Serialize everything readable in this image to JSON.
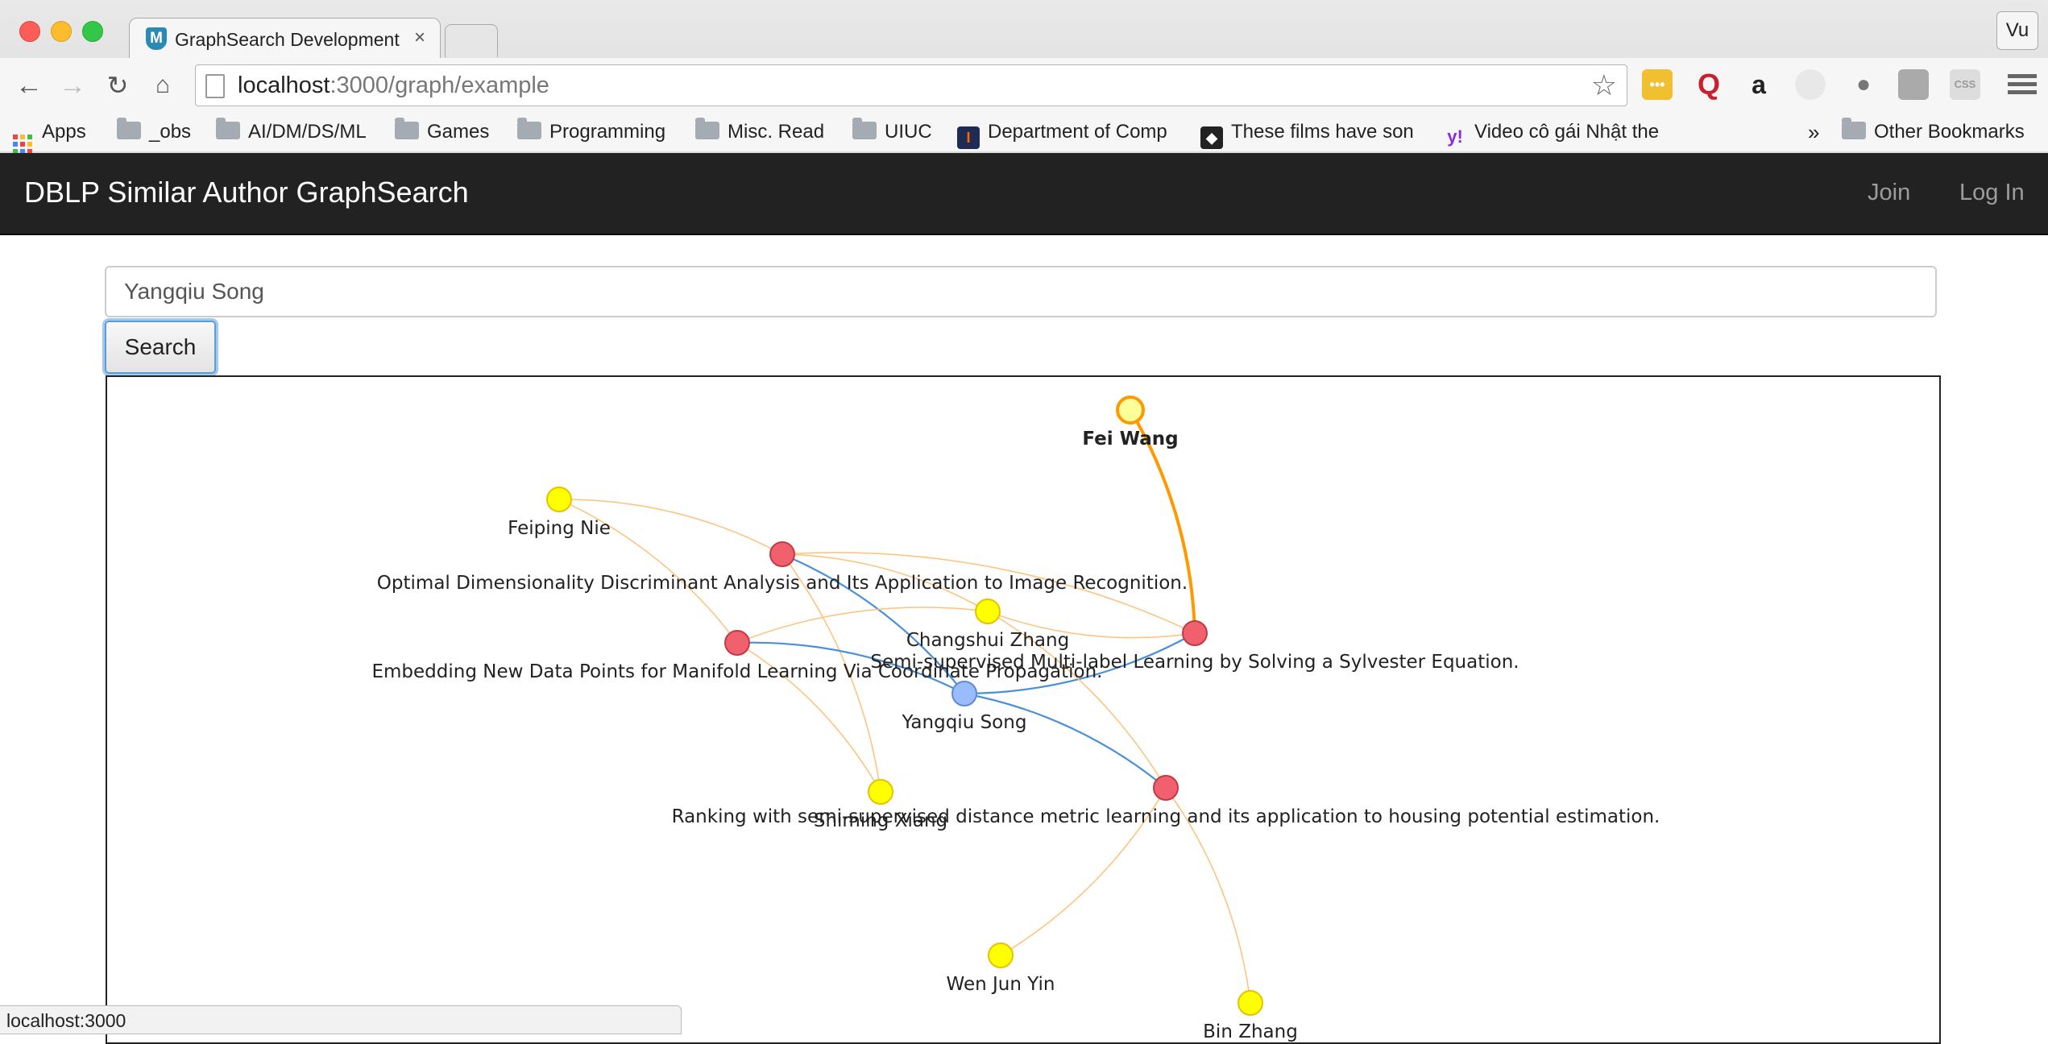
{
  "browser": {
    "tab_title": "GraphSearch Development",
    "tab_close": "×",
    "tab_favicon": "M",
    "profile": "Vu",
    "url_host": "localhost",
    "url_path": ":3000/graph/example",
    "bookmarks": {
      "apps": "Apps",
      "obs": "_obs",
      "ai": "AI/DM/DS/ML",
      "games": "Games",
      "programming": "Programming",
      "misc": "Misc. Read",
      "uiuc": "UIUC",
      "dept": "Department of Comp",
      "films": "These films have son",
      "video": "Video cô gái Nhật the",
      "more": "»",
      "other": "Other Bookmarks"
    },
    "extensions": {
      "q_label": "Q",
      "a_label": "a"
    },
    "status_url": "localhost:3000"
  },
  "app": {
    "brand": "DBLP Similar Author GraphSearch",
    "join": "Join",
    "login": "Log In"
  },
  "search": {
    "value": "Yangqiu Song",
    "button": "Search"
  },
  "graph": {
    "colors": {
      "author": "#ffff00",
      "paper": "#f0616d",
      "center": "#99bbff",
      "selected": "#ffff99",
      "link_author": "#ffc07a",
      "link_center": "#4a90d9",
      "link_selected": "#ff9900"
    },
    "nodes": [
      {
        "id": "fei",
        "label": "Fei Wang",
        "kind": "selected"
      },
      {
        "id": "feiping",
        "label": "Feiping Nie",
        "kind": "author"
      },
      {
        "id": "p1",
        "label": "Optimal Dimensionality Discriminant Analysis and Its Application to Image Recognition.",
        "kind": "paper"
      },
      {
        "id": "changshui",
        "label": "Changshui Zhang",
        "kind": "author"
      },
      {
        "id": "p2",
        "label": "Semi-supervised Multi-label Learning by Solving a Sylvester Equation.",
        "kind": "paper"
      },
      {
        "id": "p3",
        "label": "Embedding New Data Points for Manifold Learning Via Coordinate Propagation.",
        "kind": "paper"
      },
      {
        "id": "yangqiu",
        "label": "Yangqiu Song",
        "kind": "center"
      },
      {
        "id": "shiming",
        "label": "Shiming Xiang",
        "kind": "author"
      },
      {
        "id": "p4",
        "label": "Ranking with semi-supervised distance metric learning and its application to housing potential estimation.",
        "kind": "paper"
      },
      {
        "id": "wenjun",
        "label": "Wen Jun Yin",
        "kind": "author"
      },
      {
        "id": "bin",
        "label": "Bin Zhang",
        "kind": "author"
      }
    ],
    "links": [
      {
        "source": "fei",
        "target": "p2",
        "kind": "selected"
      },
      {
        "source": "feiping",
        "target": "p1",
        "kind": "author"
      },
      {
        "source": "feiping",
        "target": "p3",
        "kind": "author"
      },
      {
        "source": "p1",
        "target": "yangqiu",
        "kind": "center"
      },
      {
        "source": "p1",
        "target": "changshui",
        "kind": "author"
      },
      {
        "source": "p1",
        "target": "shiming",
        "kind": "author"
      },
      {
        "source": "p1",
        "target": "p2",
        "kind": "author"
      },
      {
        "source": "p3",
        "target": "yangqiu",
        "kind": "center"
      },
      {
        "source": "p3",
        "target": "changshui",
        "kind": "author"
      },
      {
        "source": "p3",
        "target": "shiming",
        "kind": "author"
      },
      {
        "source": "p2",
        "target": "yangqiu",
        "kind": "center"
      },
      {
        "source": "p2",
        "target": "changshui",
        "kind": "author"
      },
      {
        "source": "yangqiu",
        "target": "p4",
        "kind": "center"
      },
      {
        "source": "changshui",
        "target": "p4",
        "kind": "author"
      },
      {
        "source": "p4",
        "target": "wenjun",
        "kind": "author"
      },
      {
        "source": "p4",
        "target": "bin",
        "kind": "author"
      }
    ]
  }
}
